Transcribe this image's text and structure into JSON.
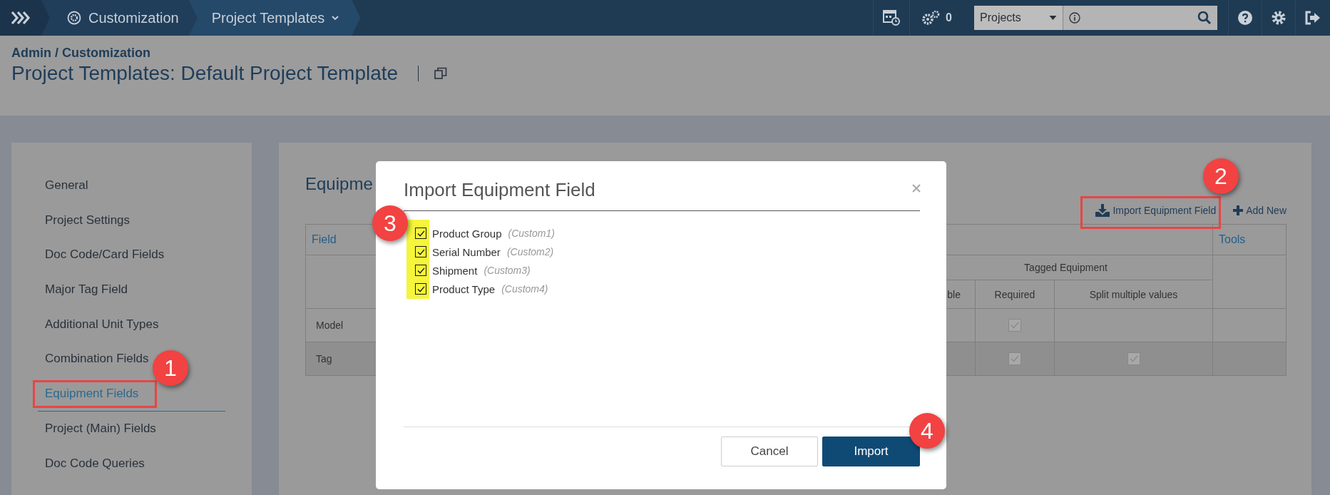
{
  "topbar": {
    "breadcrumbs": [
      {
        "label": "Customization",
        "kind": "gear"
      },
      {
        "label": "Project Templates",
        "kind": "dropdown"
      }
    ],
    "job_count": "0",
    "scope_select": {
      "value": "Projects"
    }
  },
  "header": {
    "breadcrumb": "Admin / Customization",
    "title": "Project Templates: Default Project Template"
  },
  "sidebar": {
    "items": [
      {
        "label": "General",
        "selected": false
      },
      {
        "label": "Project Settings",
        "selected": false
      },
      {
        "label": "Doc Code/Card Fields",
        "selected": false
      },
      {
        "label": "Major Tag Field",
        "selected": false
      },
      {
        "label": "Additional Unit Types",
        "selected": false
      },
      {
        "label": "Combination Fields",
        "selected": false
      },
      {
        "label": "Equipment Fields",
        "selected": true
      },
      {
        "label": "Project (Main) Fields",
        "selected": false
      },
      {
        "label": "Doc Code Queries",
        "selected": false
      }
    ]
  },
  "main": {
    "heading": "Equipme",
    "actions": [
      {
        "label": "Import Equipment Field",
        "kind": "import"
      },
      {
        "label": "Add New",
        "kind": "add"
      }
    ],
    "table": {
      "columns": {
        "field": "Field",
        "tools": "Tools",
        "group": "Tagged Equipment",
        "sub": [
          "ble",
          "Required",
          "Split multiple values"
        ]
      },
      "rows": [
        {
          "field": "Model",
          "required": true,
          "split": false
        },
        {
          "field": "Tag",
          "required": true,
          "split": true
        }
      ]
    }
  },
  "dialog": {
    "title": "Import Equipment Field",
    "options": [
      {
        "label": "Product Group",
        "note": "(Custom1)",
        "checked": true
      },
      {
        "label": "Serial Number",
        "note": "(Custom2)",
        "checked": true
      },
      {
        "label": "Shipment",
        "note": "(Custom3)",
        "checked": true
      },
      {
        "label": "Product Type",
        "note": "(Custom4)",
        "checked": true
      }
    ],
    "buttons": [
      {
        "label": "Cancel",
        "kind": "secondary"
      },
      {
        "label": "Import",
        "kind": "primary"
      }
    ]
  },
  "annotations": [
    {
      "number": "1"
    },
    {
      "number": "2"
    },
    {
      "number": "3"
    },
    {
      "number": "4"
    }
  ]
}
